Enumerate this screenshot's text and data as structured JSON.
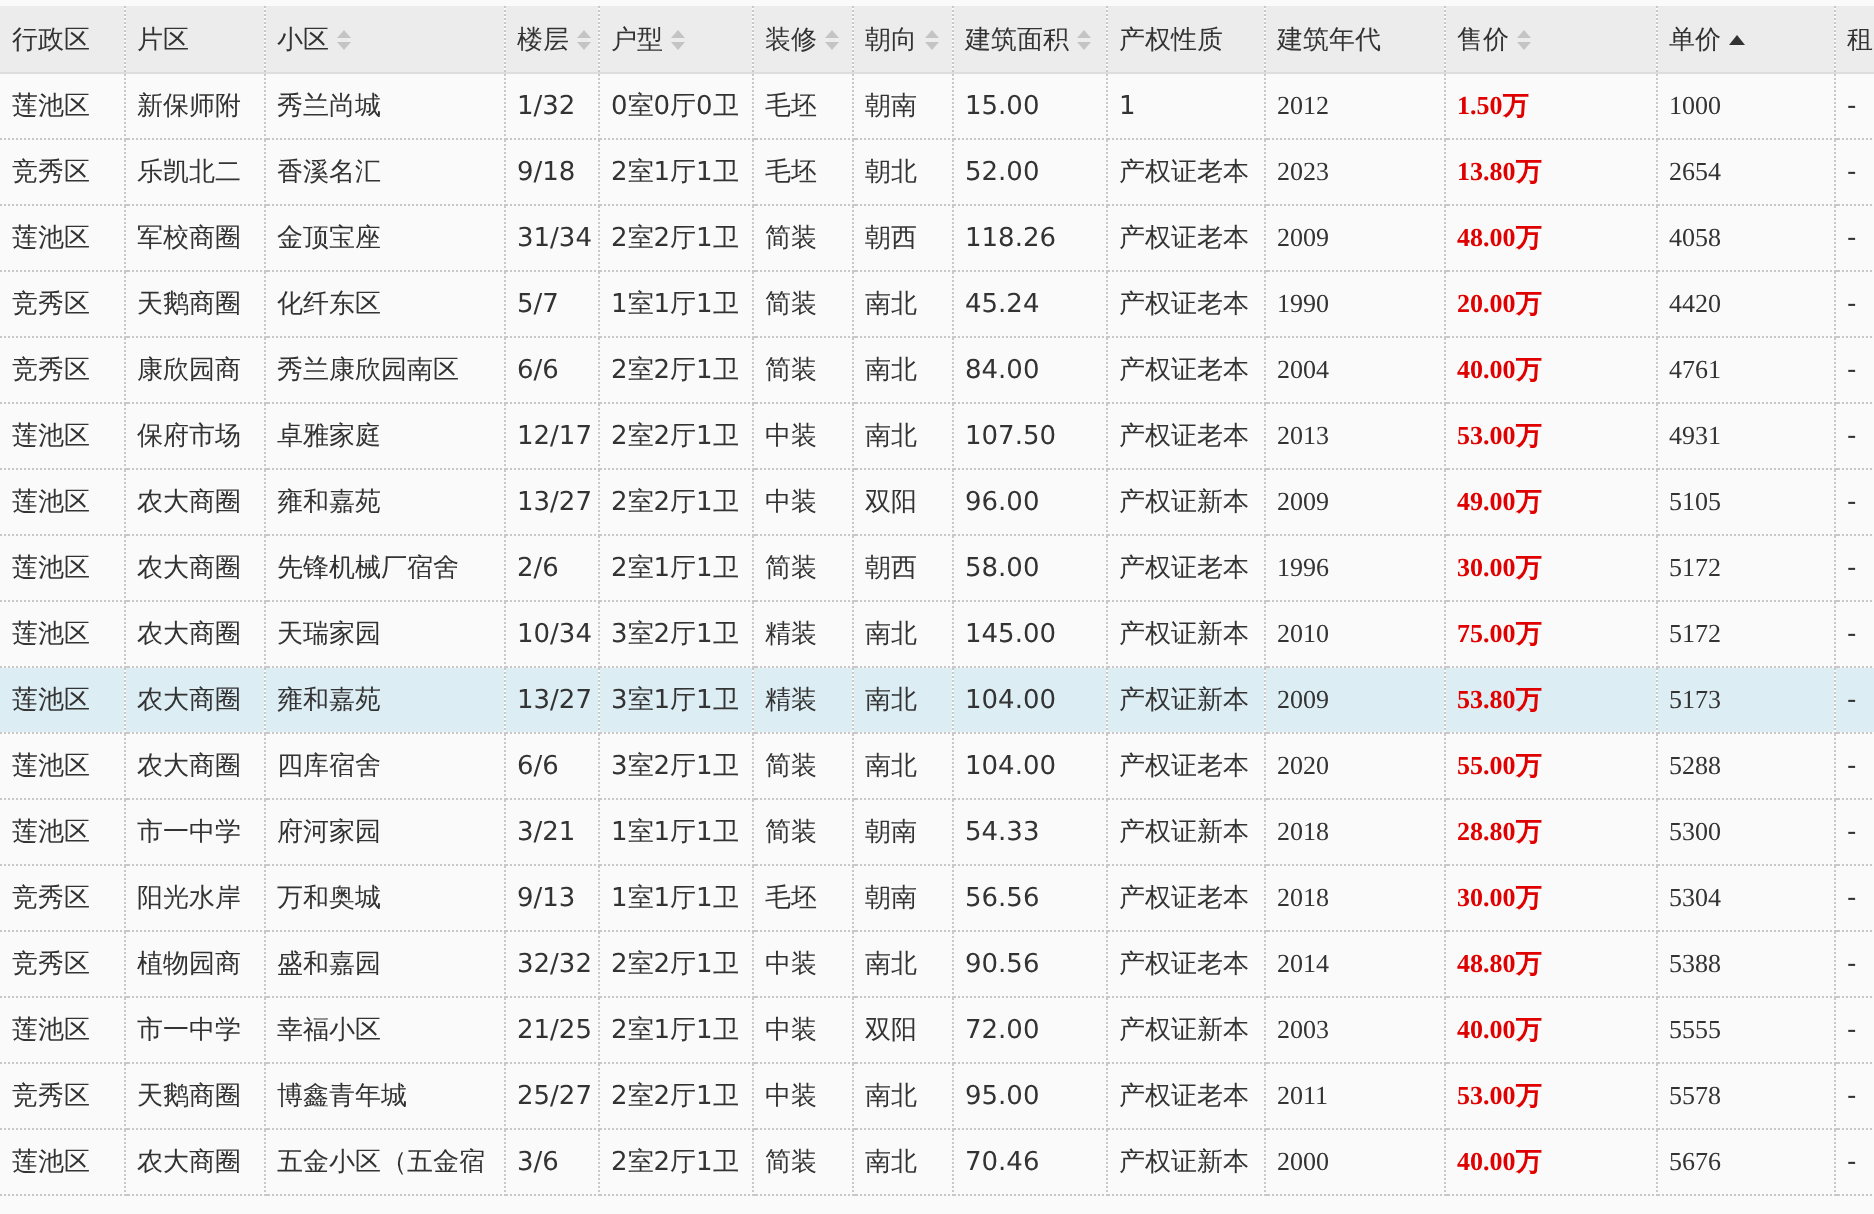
{
  "table": {
    "columns": [
      {
        "label": "行政区",
        "sortable": false,
        "sorted": false,
        "kind": "text"
      },
      {
        "label": "片区",
        "sortable": false,
        "sorted": false,
        "kind": "text"
      },
      {
        "label": "小区",
        "sortable": true,
        "sorted": false,
        "kind": "text"
      },
      {
        "label": "楼层",
        "sortable": true,
        "sorted": false,
        "kind": "text"
      },
      {
        "label": "户型",
        "sortable": true,
        "sorted": false,
        "kind": "text"
      },
      {
        "label": "装修",
        "sortable": true,
        "sorted": false,
        "kind": "text"
      },
      {
        "label": "朝向",
        "sortable": true,
        "sorted": false,
        "kind": "text"
      },
      {
        "label": "建筑面积",
        "sortable": true,
        "sorted": false,
        "kind": "text"
      },
      {
        "label": "产权性质",
        "sortable": false,
        "sorted": false,
        "kind": "text"
      },
      {
        "label": "建筑年代",
        "sortable": false,
        "sorted": false,
        "kind": "serif"
      },
      {
        "label": "售价",
        "sortable": true,
        "sorted": false,
        "kind": "price"
      },
      {
        "label": "单价",
        "sortable": true,
        "sorted": true,
        "kind": "serif"
      },
      {
        "label": "租",
        "sortable": false,
        "sorted": false,
        "kind": "text"
      }
    ],
    "rows": [
      {
        "selected": false,
        "cells": [
          "莲池区",
          "新保师附",
          "秀兰尚城",
          "1/32",
          "0室0厅0卫",
          "毛坯",
          "朝南",
          "15.00",
          "1",
          "2012",
          "1.50万",
          "1000",
          "-"
        ]
      },
      {
        "selected": false,
        "cells": [
          "竞秀区",
          "乐凯北二",
          "香溪名汇",
          "9/18",
          "2室1厅1卫",
          "毛坯",
          "朝北",
          "52.00",
          "产权证老本",
          "2023",
          "13.80万",
          "2654",
          "-"
        ]
      },
      {
        "selected": false,
        "cells": [
          "莲池区",
          "军校商圈",
          "金顶宝座",
          "31/34",
          "2室2厅1卫",
          "简装",
          "朝西",
          "118.26",
          "产权证老本",
          "2009",
          "48.00万",
          "4058",
          "-"
        ]
      },
      {
        "selected": false,
        "cells": [
          "竞秀区",
          "天鹅商圈",
          "化纤东区",
          "5/7",
          "1室1厅1卫",
          "简装",
          "南北",
          "45.24",
          "产权证老本",
          "1990",
          "20.00万",
          "4420",
          "-"
        ]
      },
      {
        "selected": false,
        "cells": [
          "竞秀区",
          "康欣园商",
          "秀兰康欣园南区",
          "6/6",
          "2室2厅1卫",
          "简装",
          "南北",
          "84.00",
          "产权证老本",
          "2004",
          "40.00万",
          "4761",
          "-"
        ]
      },
      {
        "selected": false,
        "cells": [
          "莲池区",
          "保府市场",
          "卓雅家庭",
          "12/17",
          "2室2厅1卫",
          "中装",
          "南北",
          "107.50",
          "产权证老本",
          "2013",
          "53.00万",
          "4931",
          "-"
        ]
      },
      {
        "selected": false,
        "cells": [
          "莲池区",
          "农大商圈",
          "雍和嘉苑",
          "13/27",
          "2室2厅1卫",
          "中装",
          "双阳",
          "96.00",
          "产权证新本",
          "2009",
          "49.00万",
          "5105",
          "-"
        ]
      },
      {
        "selected": false,
        "cells": [
          "莲池区",
          "农大商圈",
          "先锋机械厂宿舍",
          "2/6",
          "2室1厅1卫",
          "简装",
          "朝西",
          "58.00",
          "产权证老本",
          "1996",
          "30.00万",
          "5172",
          "-"
        ]
      },
      {
        "selected": false,
        "cells": [
          "莲池区",
          "农大商圈",
          "天瑞家园",
          "10/34",
          "3室2厅1卫",
          "精装",
          "南北",
          "145.00",
          "产权证新本",
          "2010",
          "75.00万",
          "5172",
          "-"
        ]
      },
      {
        "selected": true,
        "cells": [
          "莲池区",
          "农大商圈",
          "雍和嘉苑",
          "13/27",
          "3室1厅1卫",
          "精装",
          "南北",
          "104.00",
          "产权证新本",
          "2009",
          "53.80万",
          "5173",
          "-"
        ]
      },
      {
        "selected": false,
        "cells": [
          "莲池区",
          "农大商圈",
          "四库宿舍",
          "6/6",
          "3室2厅1卫",
          "简装",
          "南北",
          "104.00",
          "产权证老本",
          "2020",
          "55.00万",
          "5288",
          "-"
        ]
      },
      {
        "selected": false,
        "cells": [
          "莲池区",
          "市一中学",
          "府河家园",
          "3/21",
          "1室1厅1卫",
          "简装",
          "朝南",
          "54.33",
          "产权证新本",
          "2018",
          "28.80万",
          "5300",
          "-"
        ]
      },
      {
        "selected": false,
        "cells": [
          "竞秀区",
          "阳光水岸",
          "万和奥城",
          "9/13",
          "1室1厅1卫",
          "毛坯",
          "朝南",
          "56.56",
          "产权证老本",
          "2018",
          "30.00万",
          "5304",
          "-"
        ]
      },
      {
        "selected": false,
        "cells": [
          "竞秀区",
          "植物园商",
          "盛和嘉园",
          "32/32",
          "2室2厅1卫",
          "中装",
          "南北",
          "90.56",
          "产权证老本",
          "2014",
          "48.80万",
          "5388",
          "-"
        ]
      },
      {
        "selected": false,
        "cells": [
          "莲池区",
          "市一中学",
          "幸福小区",
          "21/25",
          "2室1厅1卫",
          "中装",
          "双阳",
          "72.00",
          "产权证新本",
          "2003",
          "40.00万",
          "5555",
          "-"
        ]
      },
      {
        "selected": false,
        "cells": [
          "竞秀区",
          "天鹅商圈",
          "博鑫青年城",
          "25/27",
          "2室2厅1卫",
          "中装",
          "南北",
          "95.00",
          "产权证老本",
          "2011",
          "53.00万",
          "5578",
          "-"
        ]
      },
      {
        "selected": false,
        "cells": [
          "莲池区",
          "农大商圈",
          "五金小区（五金宿",
          "3/6",
          "2室2厅1卫",
          "简装",
          "南北",
          "70.46",
          "产权证新本",
          "2000",
          "40.00万",
          "5676",
          "-"
        ]
      }
    ]
  }
}
